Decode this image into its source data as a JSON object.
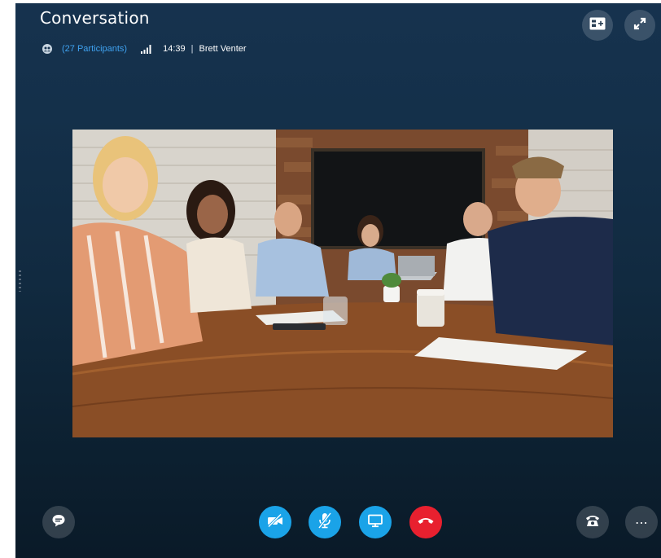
{
  "window": {
    "title": "Conversation"
  },
  "info": {
    "participants": "(27 Participants)",
    "time": "14:39",
    "separator": "|",
    "user": "Brett Venter"
  },
  "icons": {
    "participants": "people-icon",
    "signal": "signal-strength-icon",
    "layout": "layout-toggle-icon",
    "fullscreen": "expand-icon",
    "chat": "chat-bubble-icon",
    "video": "video-off-icon",
    "mic": "mic-off-icon",
    "share": "screen-share-icon",
    "hangup": "hang-up-icon",
    "dialpad": "phone-icon",
    "more": "more-icon"
  },
  "colors": {
    "accent_blue": "#1aa3e8",
    "link_blue": "#3fa2f0",
    "hangup_red": "#e8202f"
  },
  "more_label": "⋯"
}
